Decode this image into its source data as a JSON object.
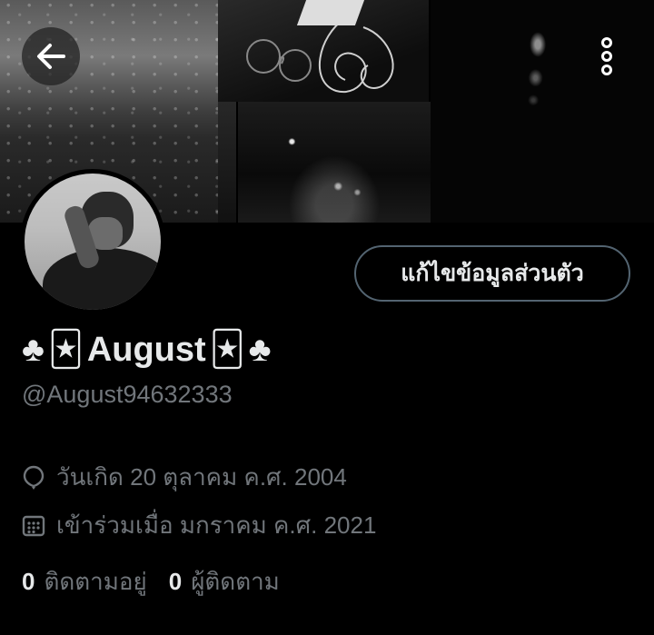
{
  "profile": {
    "display_name": "August",
    "name_prefix_symbol": "♣",
    "name_suffix_symbol": "♣",
    "name_emoji": "🃏",
    "handle": "@August94632333",
    "birthday": "วันเกิด 20 ตุลาคม ค.ศ. 2004",
    "joined": "เข้าร่วมเมื่อ มกราคม ค.ศ. 2021",
    "following_count": "0",
    "following_label": "ติดตามอยู่",
    "followers_count": "0",
    "followers_label": "ผู้ติดตาม"
  },
  "actions": {
    "edit_profile_label": "แก้ไขข้อมูลส่วนตัว",
    "back_icon": "arrow-left-icon",
    "more_icon": "more-vertical-icon"
  },
  "icons": {
    "birthday": "balloon-icon",
    "joined": "calendar-icon"
  },
  "colors": {
    "background": "#000000",
    "primary_text": "#e7e9ea",
    "secondary_text": "#71767b",
    "button_border": "#536471"
  }
}
